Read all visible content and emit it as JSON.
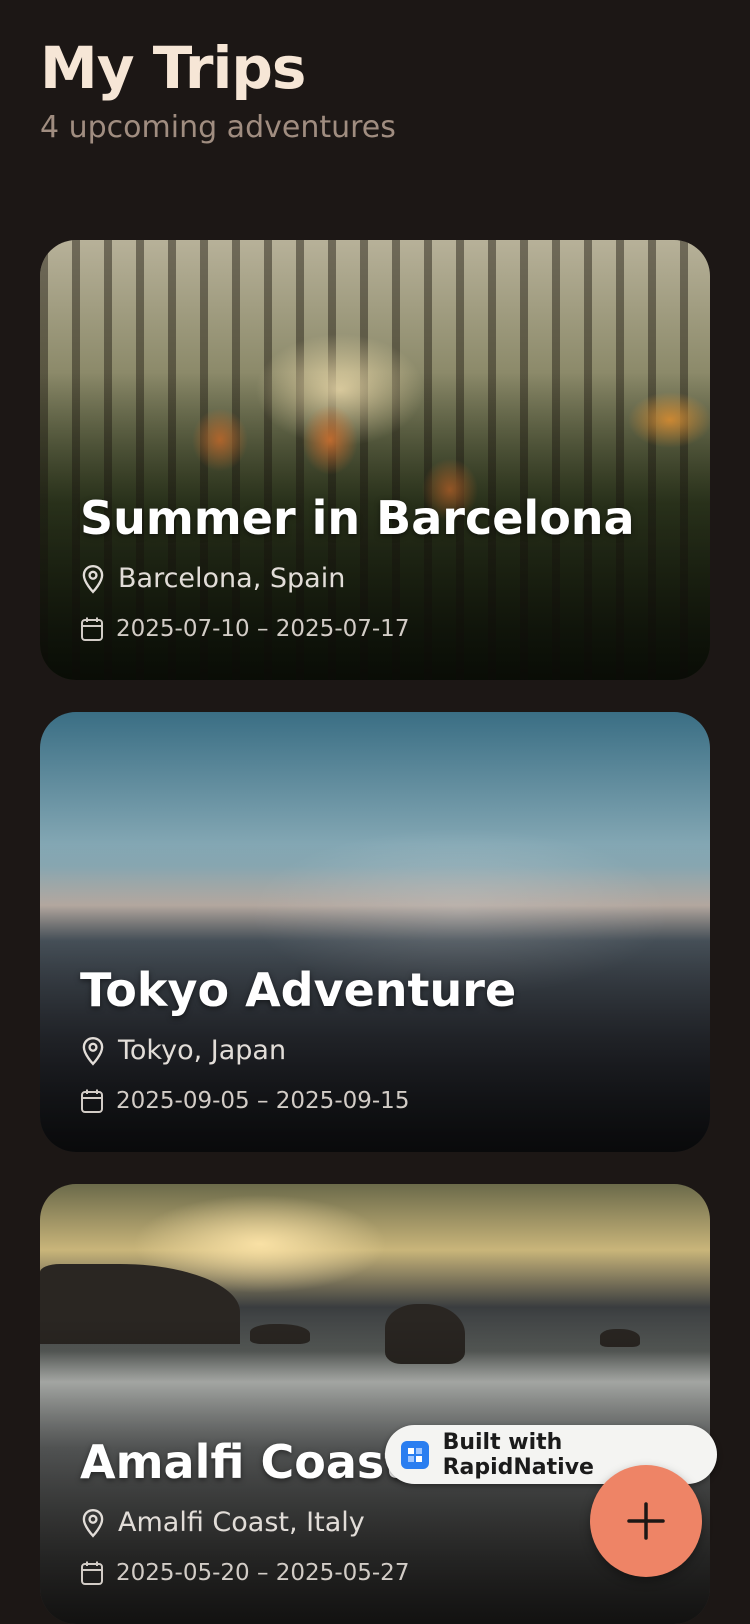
{
  "header": {
    "title": "My Trips",
    "subtitle": "4 upcoming adventures"
  },
  "trips": [
    {
      "name": "Summer in Barcelona",
      "location": "Barcelona, Spain",
      "dates": "2025-07-10 – 2025-07-17",
      "image": "tulips-forest"
    },
    {
      "name": "Tokyo Adventure",
      "location": "Tokyo, Japan",
      "dates": "2025-09-05 – 2025-09-15",
      "image": "sea-of-clouds"
    },
    {
      "name": "Amalfi Coast",
      "location": "Amalfi Coast, Italy",
      "dates": "2025-05-20 – 2025-05-27",
      "image": "rocky-coast"
    }
  ],
  "badge": {
    "label": "Built with RapidNative"
  },
  "fab": {
    "icon": "plus-icon"
  },
  "colors": {
    "background": "#1c1715",
    "title": "#f6e6d6",
    "subtitle": "#a08d80",
    "fab": "#ee8466",
    "badge_logo": "#2a7ef0"
  }
}
